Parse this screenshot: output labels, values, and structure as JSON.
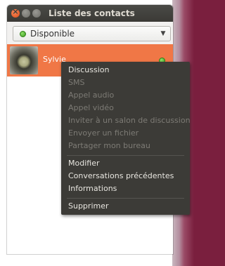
{
  "window": {
    "title": "Liste des contacts"
  },
  "status": {
    "label": "Disponible",
    "color": "#4caf2a"
  },
  "contact": {
    "name": "Sylvie",
    "status_color": "#4caf2a",
    "highlight_color": "#f07746"
  },
  "menu": {
    "items": [
      {
        "label": "Discussion",
        "enabled": true
      },
      {
        "label": "SMS",
        "enabled": false
      },
      {
        "label": "Appel audio",
        "enabled": false
      },
      {
        "label": "Appel vidéo",
        "enabled": false
      },
      {
        "label": "Inviter à un salon de discussion",
        "enabled": false
      },
      {
        "label": "Envoyer un fichier",
        "enabled": false
      },
      {
        "label": "Partager mon bureau",
        "enabled": false
      },
      {
        "label": "Modifier",
        "enabled": true
      },
      {
        "label": "Conversations précédentes",
        "enabled": true
      },
      {
        "label": "Informations",
        "enabled": true
      },
      {
        "label": "Supprimer",
        "enabled": true
      }
    ]
  }
}
